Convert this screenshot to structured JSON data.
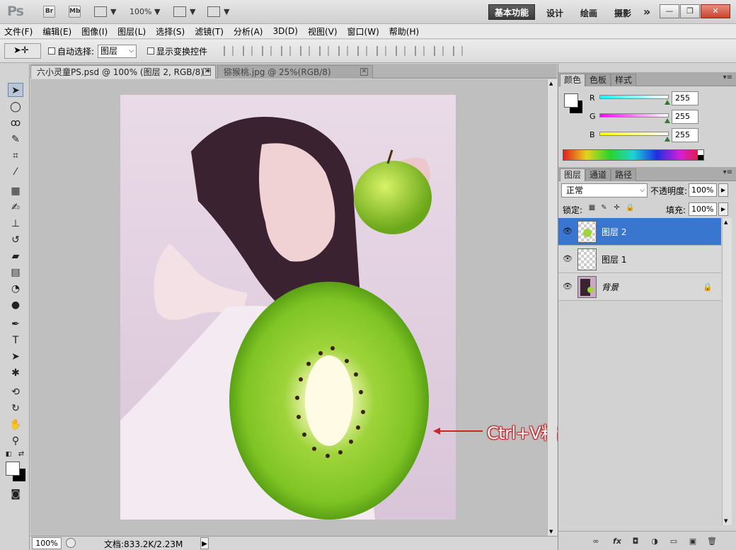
{
  "titlebar": {
    "logo": "Ps",
    "buttons": [
      "Br",
      "Mb"
    ],
    "zoom": "100%",
    "workspaces": [
      "基本功能",
      "设计",
      "绘画",
      "摄影"
    ],
    "more": "»"
  },
  "menubar": [
    "文件(F)",
    "编辑(E)",
    "图像(I)",
    "图层(L)",
    "选择(S)",
    "滤镜(T)",
    "分析(A)",
    "3D(D)",
    "视图(V)",
    "窗口(W)",
    "帮助(H)"
  ],
  "options": {
    "auto_select_label": "自动选择:",
    "auto_select_value": "图层",
    "show_transform_label": "显示变换控件"
  },
  "tabs": [
    {
      "label": "六小灵童PS.psd @ 100% (图层 2, RGB/8) *"
    },
    {
      "label": "猕猴桃.jpg @ 25%(RGB/8)"
    }
  ],
  "canvas": {
    "annotation": "Ctrl+V粘贴进入"
  },
  "statusbar": {
    "zoom": "100%",
    "doc": "文档:833.2K/2.23M"
  },
  "color_panel": {
    "tabs": [
      "颜色",
      "色板",
      "样式"
    ],
    "channels": [
      {
        "label": "R",
        "value": "255",
        "color": "#2ec8c8"
      },
      {
        "label": "G",
        "value": "255",
        "color": "#d42ed4"
      },
      {
        "label": "B",
        "value": "255",
        "color": "#e8e82e"
      }
    ]
  },
  "layers_panel": {
    "tabs": [
      "图层",
      "通道",
      "路径"
    ],
    "blend_mode": "正常",
    "opacity_label": "不透明度:",
    "opacity": "100%",
    "lock_label": "锁定:",
    "fill_label": "填充:",
    "fill": "100%",
    "layers": [
      {
        "name": "图层 2",
        "selected": true
      },
      {
        "name": "图层 1",
        "selected": false
      },
      {
        "name": "背景",
        "selected": false,
        "locked": true
      }
    ]
  },
  "colors": {
    "selection": "#3876cf",
    "annotation": "#c8282a"
  }
}
